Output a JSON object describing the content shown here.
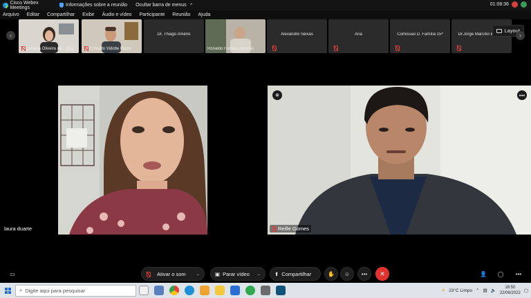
{
  "window": {
    "app_title": "Cisco Webex Meetings",
    "meeting_info": "Informações sobre a reunião",
    "hide_menu": "Ocultar barra de menus",
    "timer": "01:08:36"
  },
  "menu": [
    "Arquivo",
    "Editar",
    "Compartilhar",
    "Exibir",
    "Áudio e vídeo",
    "Participante",
    "Reunião",
    "Ajuda"
  ],
  "thumbnails": [
    {
      "name": "Luciana Oliveira da... (Eu)",
      "video": true,
      "muted": true
    },
    {
      "name": "Conrado Vidotte Plaza",
      "video": true,
      "muted": true
    },
    {
      "name": "Dr. Thiago Amério",
      "video": false,
      "muted": false
    },
    {
      "name": "Ronaldo Fontes Linhares",
      "video": true,
      "muted": false
    },
    {
      "name": "Alexandre Seixas",
      "video": false,
      "muted": true
    },
    {
      "name": "Ana",
      "video": false,
      "muted": true
    },
    {
      "name": "Comissão D. Família 15ª",
      "video": false,
      "muted": true
    },
    {
      "name": "Dr.Jorge Marcílio Bezerra",
      "video": false,
      "muted": true
    }
  ],
  "layout_button": "Layout",
  "main_videos": [
    {
      "name": "laura duarte"
    },
    {
      "name": "Reille Gomes"
    }
  ],
  "controls": {
    "unmute": "Ativar o som",
    "stop_video": "Parar vídeo",
    "share": "Compartilhar"
  },
  "taskbar": {
    "search_placeholder": "Digite aqui para pesquisar",
    "weather": "23°C  Limpo",
    "time": "18:50",
    "date": "22/06/2022"
  },
  "colors": {
    "end_call": "#e0322e",
    "muted_icon": "#e0403c",
    "tile_bg": "#2b2b2b"
  }
}
